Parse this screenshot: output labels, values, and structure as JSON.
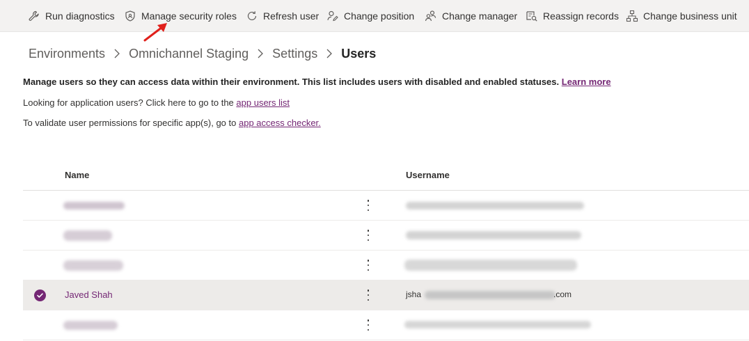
{
  "command_bar": {
    "items": [
      {
        "label": "Run diagnostics",
        "icon": "wrench-icon"
      },
      {
        "label": "Manage security roles",
        "icon": "shield-icon"
      },
      {
        "label": "Refresh user",
        "icon": "refresh-icon"
      },
      {
        "label": "Change position",
        "icon": "person-edit-icon"
      },
      {
        "label": "Change manager",
        "icon": "people-icon"
      },
      {
        "label": "Reassign records",
        "icon": "document-search-icon"
      },
      {
        "label": "Change business unit",
        "icon": "org-chart-icon"
      }
    ]
  },
  "breadcrumb": [
    "Environments",
    "Omnichannel Staging",
    "Settings",
    "Users"
  ],
  "intro": {
    "description": "Manage users so they can access data within their environment. This list includes users with disabled and enabled statuses.",
    "learn_more": "Learn more",
    "app_users_text": "Looking for application users? Click here to go to the",
    "app_users_link": "app users list",
    "checker_text": "To validate user permissions for specific app(s), go to",
    "checker_link": "app access checker."
  },
  "grid": {
    "columns": [
      "Name",
      "Username"
    ],
    "selected_row": {
      "name": "Javed Shah",
      "username_prefix": "jsha",
      "username_suffix": ".com"
    }
  },
  "colors": {
    "accent": "#742774",
    "command_bar_bg": "#f3f2f1",
    "selected_row_bg": "#edebe9",
    "annotation_arrow": "#e0201b"
  }
}
